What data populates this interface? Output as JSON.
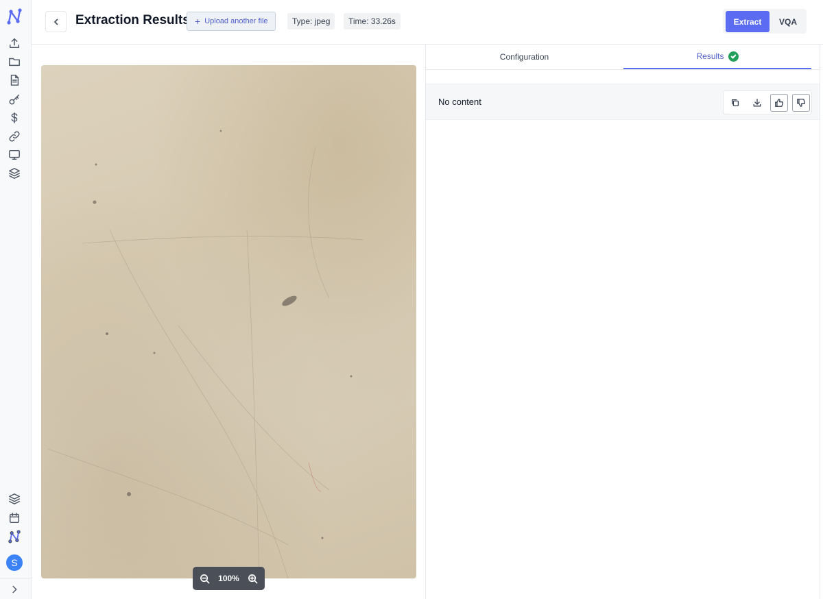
{
  "header": {
    "title": "Extraction Results",
    "upload_label": "Upload another file",
    "type_tag": "Type: jpeg",
    "time_tag": "Time: 33.26s",
    "mode_buttons": {
      "extract": "Extract",
      "vqa": "VQA"
    },
    "active_mode": "Extract"
  },
  "sidebar": {
    "items": [
      "upload-icon",
      "folder-icon",
      "document-icon",
      "key-icon",
      "dollar-icon",
      "link-icon",
      "monitor-icon",
      "layers-icon"
    ],
    "bottom_items": [
      "layers-icon",
      "calendar-icon",
      "logo-icon"
    ],
    "avatar_initial": "S"
  },
  "viewer": {
    "zoom_level": "100%"
  },
  "results": {
    "tabs": [
      {
        "label": "Configuration",
        "active": false
      },
      {
        "label": "Results",
        "active": true,
        "status": "success"
      }
    ],
    "content": "No content",
    "actions": [
      "copy-icon",
      "download-icon",
      "thumbs-up-icon",
      "thumbs-down-icon"
    ]
  },
  "colors": {
    "accent": "#5b6cf2",
    "success": "#22a05b",
    "avatar": "#3b82f6"
  }
}
